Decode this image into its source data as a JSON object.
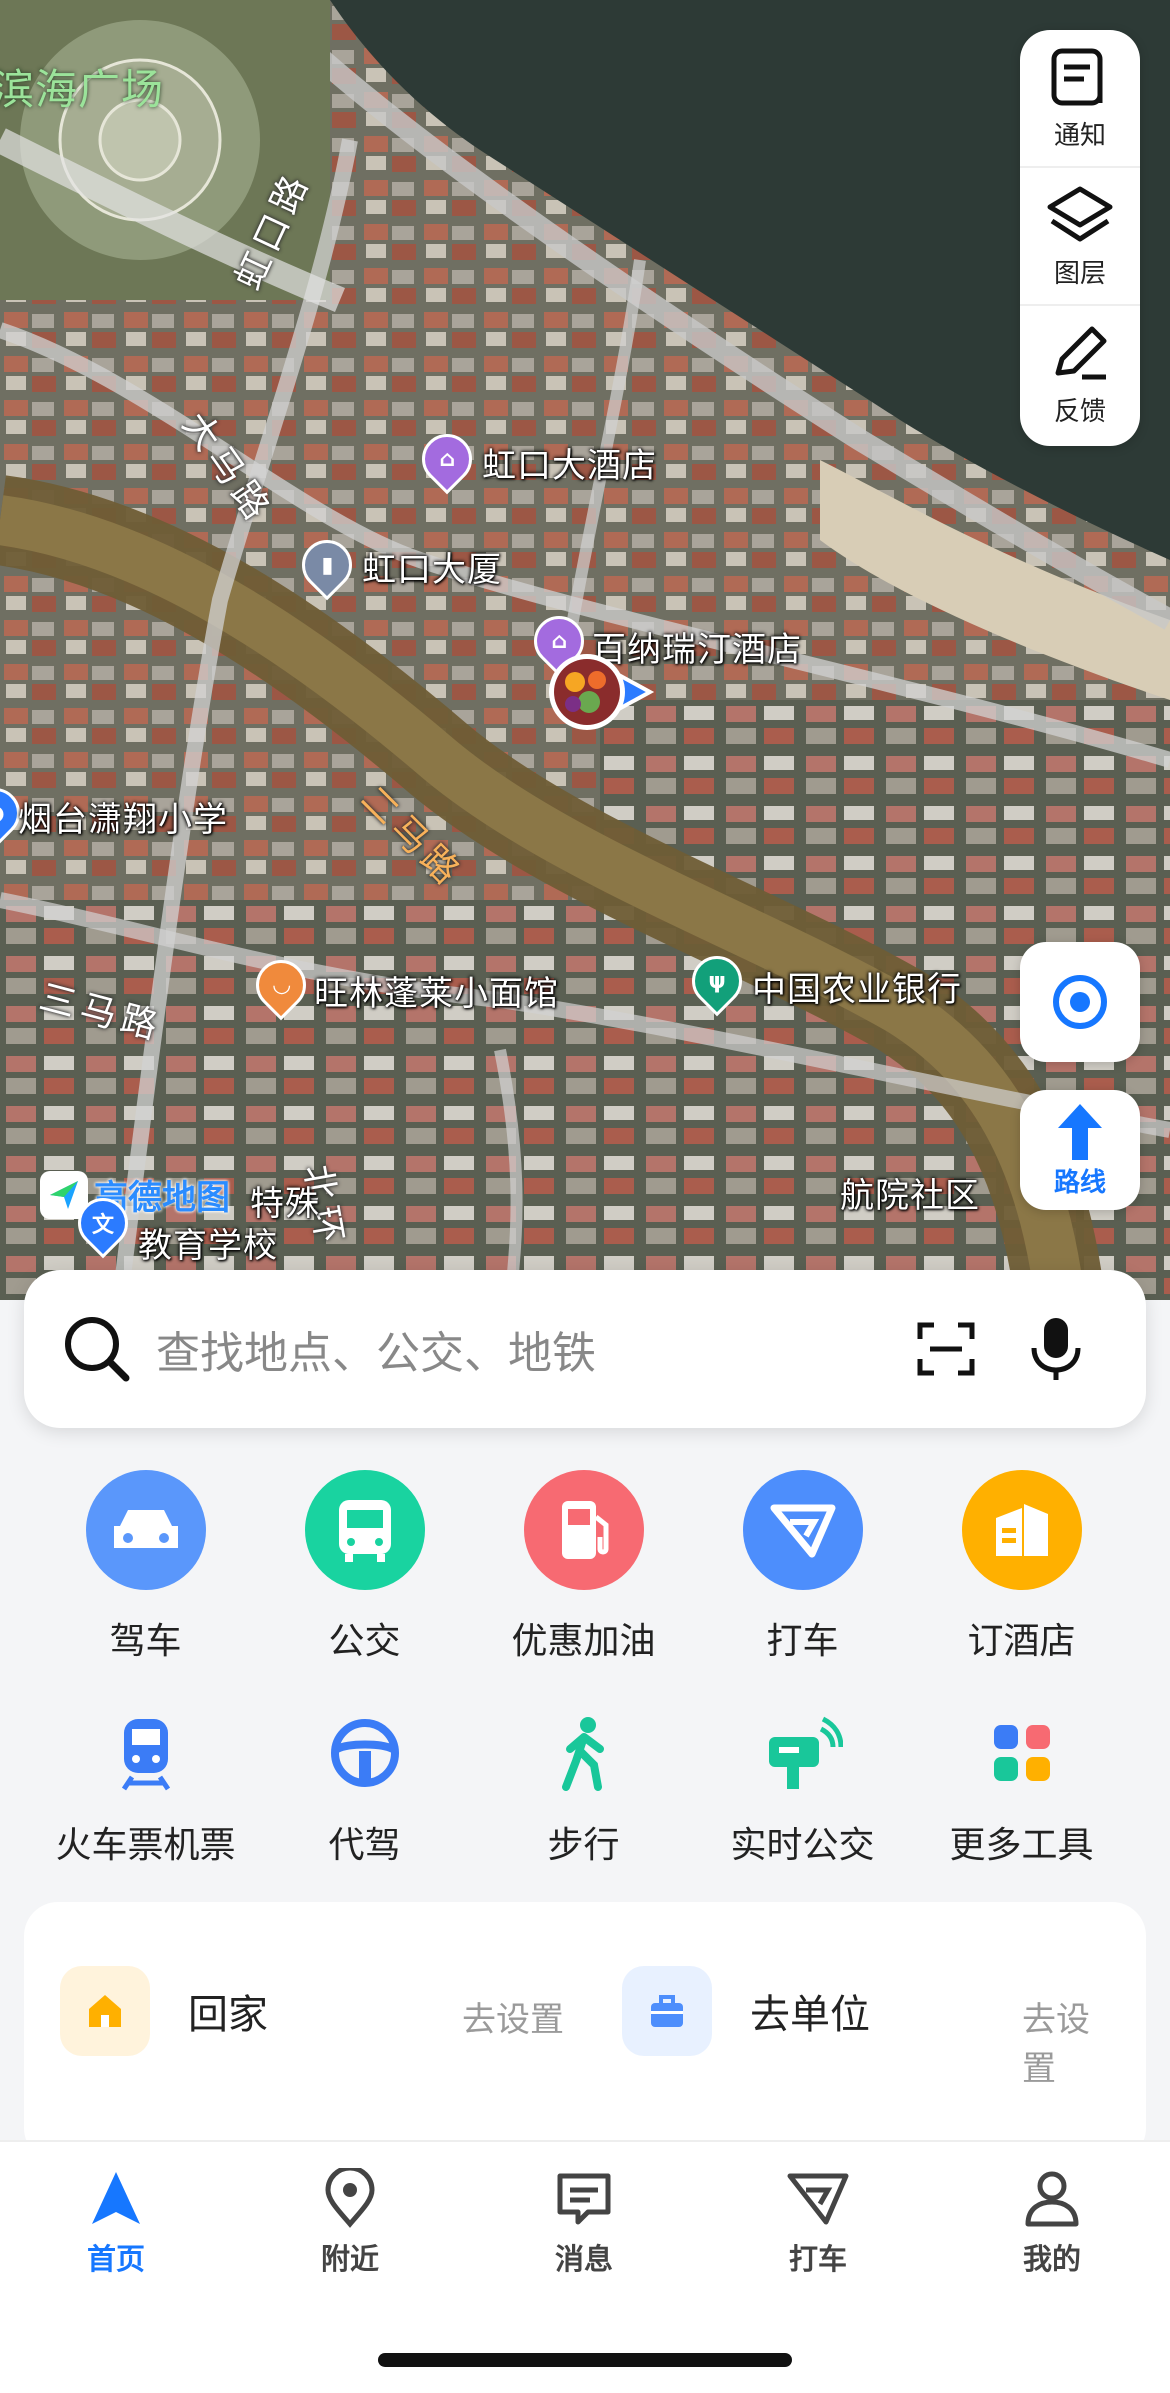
{
  "map": {
    "labels": {
      "square": "滨海广场",
      "hotel1": "虹口大酒店",
      "building": "虹口大厦",
      "hotel2": "百纳瑞汀酒店",
      "school1": "烟台潇翔小学",
      "restaurant": "旺林蓬莱小面馆",
      "bank": "中国农业银行",
      "school2_line1": "特殊",
      "school2_line2": "教育学校",
      "community": "航院社区",
      "logo": "高德地图"
    },
    "roads": {
      "hongkou": "虹口路",
      "dama": "大马路",
      "erma": "二马路",
      "sanma": "三马路",
      "beihuan": "北环"
    }
  },
  "controls": {
    "notice": "通知",
    "layers": "图层",
    "feedback": "反馈",
    "route": "路线"
  },
  "search": {
    "placeholder": "查找地点、公交、地铁"
  },
  "tools_row1": [
    {
      "label": "驾车",
      "icon": "car-icon",
      "color": "#5a97fb"
    },
    {
      "label": "公交",
      "icon": "bus-icon",
      "color": "#19d3a0"
    },
    {
      "label": "优惠加油",
      "icon": "gas-station-icon",
      "color": "#f76a72"
    },
    {
      "label": "打车",
      "icon": "taxi-icon",
      "color": "#4d8efc"
    },
    {
      "label": "订酒店",
      "icon": "hotel-icon",
      "color": "#ffb000"
    }
  ],
  "tools_row2": [
    {
      "label": "火车票机票",
      "icon": "train-icon"
    },
    {
      "label": "代驾",
      "icon": "steering-wheel-icon"
    },
    {
      "label": "步行",
      "icon": "walk-icon"
    },
    {
      "label": "实时公交",
      "icon": "realtime-bus-icon"
    },
    {
      "label": "更多工具",
      "icon": "more-tools-icon"
    }
  ],
  "shortcuts": {
    "home": "回家",
    "home_set": "去设置",
    "work": "去单位",
    "work_set": "去设置"
  },
  "tabbar": [
    {
      "label": "首页",
      "active": true
    },
    {
      "label": "附近"
    },
    {
      "label": "消息"
    },
    {
      "label": "打车"
    },
    {
      "label": "我的"
    }
  ],
  "colors": {
    "accent": "#1677ff"
  }
}
